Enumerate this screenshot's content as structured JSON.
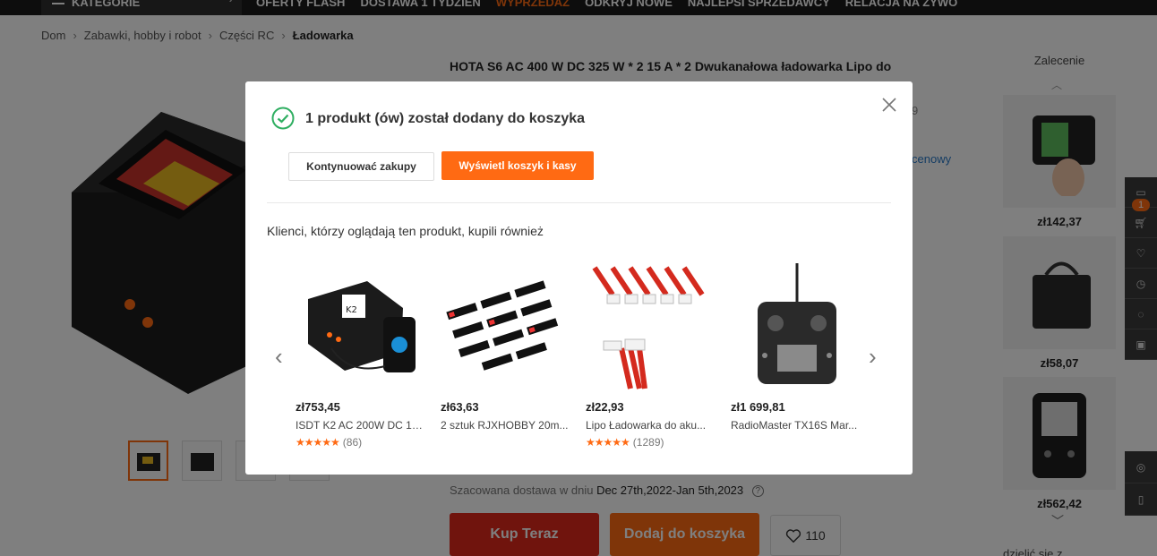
{
  "nav": {
    "categories_label": "KATEGORIE",
    "items": [
      "OFERTY FLASH",
      "DOSTAWA 1 TYDZIEŃ",
      "WYPRZEDAŻ",
      "ODKRYJ NOWE",
      "NAJLEPSI SPRZEDAWCY",
      "RELACJA NA ŻYWO"
    ],
    "highlight_color": "#ff6a13"
  },
  "breadcrumb": [
    "Dom",
    "Zabawki, hobby i robot",
    "Części RC",
    "Ładowarka"
  ],
  "product": {
    "title": "HOTA S6 AC 400 W DC 325 W * 2 15 A * 2 Dwukanałowa ładowarka Lipo do",
    "faint_rating": "9",
    "faint_link": "cenowy",
    "delivery_label": "Szacowana dostawa w dniu",
    "delivery_dates": "Dec 27th,2022-Jan 5th,2023",
    "buy_now": "Kup Teraz",
    "add_to_cart": "Dodaj do koszyka",
    "wishlist_count": "110"
  },
  "recommendation": {
    "title": "Zalecenie",
    "prices": [
      "zł142,37",
      "zł58,07",
      "zł562,42"
    ],
    "more_text": "dzielić się z"
  },
  "toolbar": {
    "cart_count": "1"
  },
  "modal": {
    "heading": "1 produkt (ów) został dodany do koszyka",
    "continue_label": "Kontynuować zakupy",
    "view_cart_label": "Wyświetl koszyk i kasy",
    "also_bought": "Klienci, którzy oglądają ten produkt, kupili również",
    "products": [
      {
        "price": "zł753,45",
        "name": "ISDT K2 AC 200W DC 10...",
        "stars": 5,
        "count": "(86)"
      },
      {
        "price": "zł63,63",
        "name": "2 sztuk RJXHOBBY 20m...",
        "stars": 0,
        "count": ""
      },
      {
        "price": "zł22,93",
        "name": "Lipo Ładowarka do aku...",
        "stars": 5,
        "count": "(1289)"
      },
      {
        "price": "zł1 699,81",
        "name": "RadioMaster TX16S Mar...",
        "stars": 0,
        "count": ""
      }
    ]
  }
}
